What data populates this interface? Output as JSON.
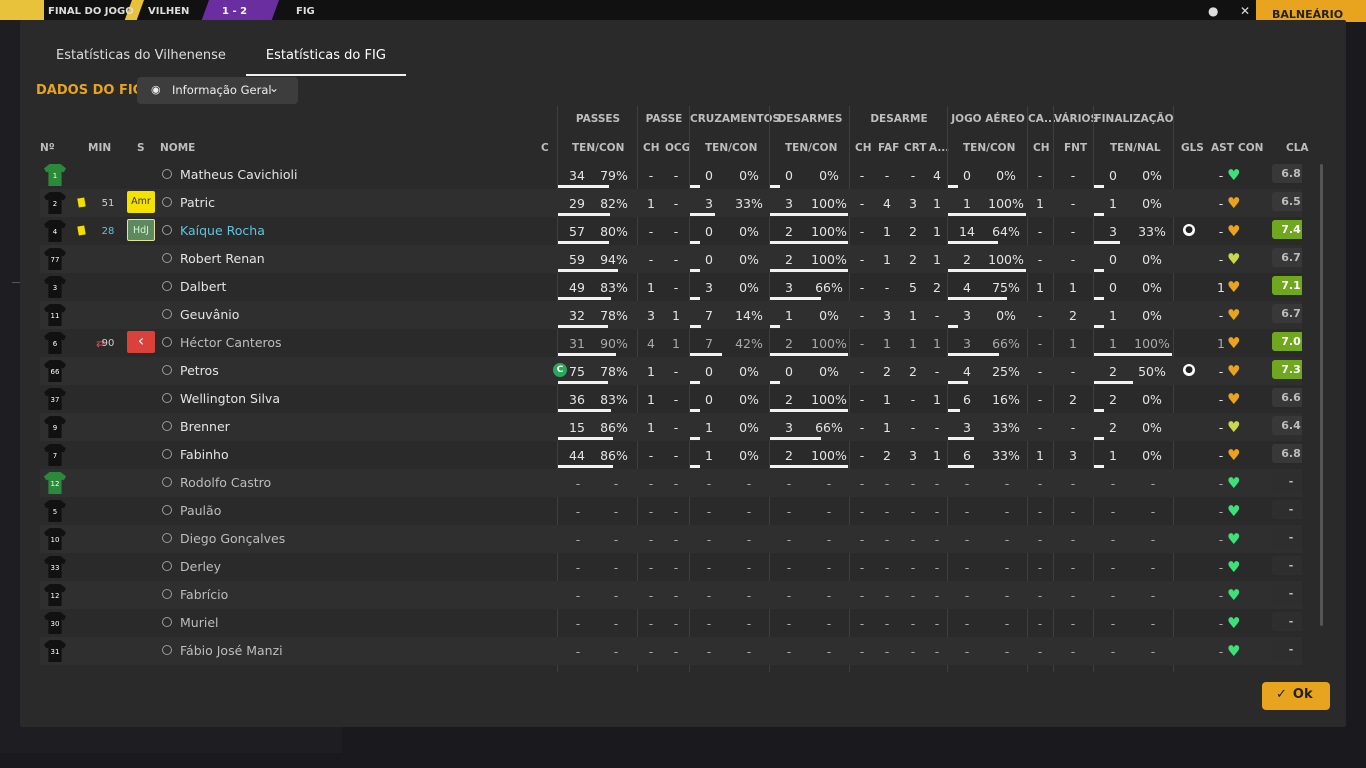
{
  "topbar": {
    "status": "FINAL DO JOGO",
    "home_team": "VILHEN",
    "score": "1 - 2",
    "away_team": "FIG",
    "right_icons": [
      "people-icon",
      "close-icon"
    ],
    "right_button": "BALNEÁRIO"
  },
  "tabs": [
    {
      "label": "Estatísticas do Vilhenense",
      "active": false
    },
    {
      "label": "Estatísticas do FIG",
      "active": true
    }
  ],
  "section_title": "DADOS DO FIG",
  "view_select": {
    "label": "Informação Geral"
  },
  "groups": [
    "PASSES",
    "PASSE",
    "CRUZAMENTOS",
    "DESARMES",
    "DESARME",
    "JOGO AÉREO",
    "CA...",
    "VÁRIOS",
    "FINALIZAÇÃO"
  ],
  "columns": [
    "Nº",
    "MIN",
    "S",
    "NOME",
    "C",
    "TEN/CON",
    "CH",
    "OCG",
    "TEN/CON",
    "TEN/CON",
    "CH",
    "FAF",
    "CRT",
    "A...",
    "TEN/CON",
    "CH",
    "FNT",
    "TEN/NAL",
    "GLS",
    "AST",
    "CON",
    "CLA"
  ],
  "colors": {
    "accent": "#e8a41e",
    "link": "#5fc4de",
    "rating_good": "#6fa81f",
    "heart_green": "#3ee07a",
    "heart_orange": "#e8a41e"
  },
  "players": [
    {
      "num": "1",
      "gk": true,
      "card": false,
      "min": "",
      "pos": "",
      "name": "Matheus Cavichioli",
      "link": false,
      "c": "",
      "pass": [
        "34",
        "79%"
      ],
      "pass_pct": 79,
      "ch": "-",
      "ocg": "-",
      "cross": [
        "0",
        "0%"
      ],
      "cross_pct": 0,
      "tack": [
        "0",
        "0%"
      ],
      "tack_pct": 0,
      "d_ch": "-",
      "faf": "-",
      "crt": "-",
      "a": "4",
      "air": [
        "0",
        "0%"
      ],
      "air_pct": 0,
      "ca": "-",
      "fnt": "-",
      "shots": [
        "0",
        "0%"
      ],
      "shot_pct": 0,
      "gls": "",
      "ast": "-",
      "con": "green",
      "cla": "6.8",
      "cla_good": false
    },
    {
      "num": "2",
      "gk": false,
      "card": true,
      "min": "51",
      "pos": "Amr",
      "name": "Patric",
      "link": false,
      "c": "",
      "pass": [
        "29",
        "82%"
      ],
      "pass_pct": 82,
      "ch": "1",
      "ocg": "-",
      "cross": [
        "3",
        "33%"
      ],
      "cross_pct": 33,
      "tack": [
        "3",
        "100%"
      ],
      "tack_pct": 100,
      "d_ch": "-",
      "faf": "4",
      "crt": "3",
      "a": "1",
      "air": [
        "1",
        "100%"
      ],
      "air_pct": 100,
      "ca": "1",
      "fnt": "-",
      "shots": [
        "1",
        "0%"
      ],
      "shot_pct": 0,
      "gls": "",
      "ast": "-",
      "con": "orange",
      "cla": "6.5",
      "cla_good": false
    },
    {
      "num": "4",
      "gk": false,
      "card": true,
      "min": "28",
      "pos": "HdJ",
      "name": "Kaíque Rocha",
      "link": true,
      "c": "",
      "pass": [
        "57",
        "80%"
      ],
      "pass_pct": 80,
      "ch": "-",
      "ocg": "-",
      "cross": [
        "0",
        "0%"
      ],
      "cross_pct": 0,
      "tack": [
        "2",
        "100%"
      ],
      "tack_pct": 100,
      "d_ch": "-",
      "faf": "1",
      "crt": "2",
      "a": "1",
      "air": [
        "14",
        "64%"
      ],
      "air_pct": 64,
      "ca": "-",
      "fnt": "-",
      "shots": [
        "3",
        "33%"
      ],
      "shot_pct": 33,
      "gls": "ball",
      "ast": "-",
      "con": "orange",
      "cla": "7.4",
      "cla_good": true
    },
    {
      "num": "77",
      "gk": false,
      "card": false,
      "min": "",
      "pos": "",
      "name": "Robert Renan",
      "link": false,
      "c": "",
      "pass": [
        "59",
        "94%"
      ],
      "pass_pct": 94,
      "ch": "-",
      "ocg": "-",
      "cross": [
        "0",
        "0%"
      ],
      "cross_pct": 0,
      "tack": [
        "2",
        "100%"
      ],
      "tack_pct": 100,
      "d_ch": "-",
      "faf": "1",
      "crt": "2",
      "a": "1",
      "air": [
        "2",
        "100%"
      ],
      "air_pct": 100,
      "ca": "-",
      "fnt": "-",
      "shots": [
        "0",
        "0%"
      ],
      "shot_pct": 0,
      "gls": "",
      "ast": "-",
      "con": "yellow",
      "cla": "6.7",
      "cla_good": false
    },
    {
      "num": "3",
      "gk": false,
      "card": false,
      "min": "",
      "pos": "",
      "name": "Dalbert",
      "link": false,
      "c": "",
      "pass": [
        "49",
        "83%"
      ],
      "pass_pct": 83,
      "ch": "1",
      "ocg": "-",
      "cross": [
        "3",
        "0%"
      ],
      "cross_pct": 0,
      "tack": [
        "3",
        "66%"
      ],
      "tack_pct": 66,
      "d_ch": "-",
      "faf": "-",
      "crt": "5",
      "a": "2",
      "air": [
        "4",
        "75%"
      ],
      "air_pct": 75,
      "ca": "1",
      "fnt": "1",
      "shots": [
        "0",
        "0%"
      ],
      "shot_pct": 0,
      "gls": "",
      "ast": "1",
      "con": "orange",
      "cla": "7.1",
      "cla_good": true
    },
    {
      "num": "11",
      "gk": false,
      "card": false,
      "min": "",
      "pos": "",
      "name": "Geuvânio",
      "link": false,
      "c": "",
      "pass": [
        "32",
        "78%"
      ],
      "pass_pct": 78,
      "ch": "3",
      "ocg": "1",
      "cross": [
        "7",
        "14%"
      ],
      "cross_pct": 14,
      "tack": [
        "1",
        "0%"
      ],
      "tack_pct": 0,
      "d_ch": "-",
      "faf": "3",
      "crt": "1",
      "a": "-",
      "air": [
        "3",
        "0%"
      ],
      "air_pct": 0,
      "ca": "-",
      "fnt": "2",
      "shots": [
        "1",
        "0%"
      ],
      "shot_pct": 0,
      "gls": "",
      "ast": "-",
      "con": "orange",
      "cla": "6.7",
      "cla_good": false
    },
    {
      "num": "6",
      "gk": false,
      "card": false,
      "sub": true,
      "min": "90",
      "pos": "out",
      "name": "Héctor Canteros",
      "link": false,
      "dim": true,
      "c": "",
      "pass": [
        "31",
        "90%"
      ],
      "pass_pct": 90,
      "ch": "4",
      "ocg": "1",
      "cross": [
        "7",
        "42%"
      ],
      "cross_pct": 42,
      "tack": [
        "2",
        "100%"
      ],
      "tack_pct": 100,
      "d_ch": "-",
      "faf": "1",
      "crt": "1",
      "a": "1",
      "air": [
        "3",
        "66%"
      ],
      "air_pct": 66,
      "ca": "-",
      "fnt": "1",
      "shots": [
        "1",
        "100%"
      ],
      "shot_pct": 100,
      "gls": "",
      "ast": "1",
      "con": "orange",
      "cla": "7.0",
      "cla_good": true
    },
    {
      "num": "66",
      "gk": false,
      "card": false,
      "min": "",
      "pos": "",
      "name": "Petros",
      "link": false,
      "c": "C",
      "pass": [
        "75",
        "78%"
      ],
      "pass_pct": 78,
      "ch": "1",
      "ocg": "-",
      "cross": [
        "0",
        "0%"
      ],
      "cross_pct": 0,
      "tack": [
        "0",
        "0%"
      ],
      "tack_pct": 0,
      "d_ch": "-",
      "faf": "2",
      "crt": "2",
      "a": "-",
      "air": [
        "4",
        "25%"
      ],
      "air_pct": 25,
      "ca": "-",
      "fnt": "-",
      "shots": [
        "2",
        "50%"
      ],
      "shot_pct": 50,
      "gls": "ball",
      "ast": "-",
      "con": "orange",
      "cla": "7.3",
      "cla_good": true
    },
    {
      "num": "37",
      "gk": false,
      "card": false,
      "min": "",
      "pos": "",
      "name": "Wellington Silva",
      "link": false,
      "c": "",
      "pass": [
        "36",
        "83%"
      ],
      "pass_pct": 83,
      "ch": "1",
      "ocg": "-",
      "cross": [
        "0",
        "0%"
      ],
      "cross_pct": 0,
      "tack": [
        "2",
        "100%"
      ],
      "tack_pct": 100,
      "d_ch": "-",
      "faf": "1",
      "crt": "-",
      "a": "1",
      "air": [
        "6",
        "16%"
      ],
      "air_pct": 16,
      "ca": "-",
      "fnt": "2",
      "shots": [
        "2",
        "0%"
      ],
      "shot_pct": 0,
      "gls": "",
      "ast": "-",
      "con": "orange",
      "cla": "6.6",
      "cla_good": false
    },
    {
      "num": "9",
      "gk": false,
      "card": false,
      "min": "",
      "pos": "",
      "name": "Brenner",
      "link": false,
      "c": "",
      "pass": [
        "15",
        "86%"
      ],
      "pass_pct": 86,
      "ch": "1",
      "ocg": "-",
      "cross": [
        "1",
        "0%"
      ],
      "cross_pct": 0,
      "tack": [
        "3",
        "66%"
      ],
      "tack_pct": 66,
      "d_ch": "-",
      "faf": "1",
      "crt": "-",
      "a": "-",
      "air": [
        "3",
        "33%"
      ],
      "air_pct": 33,
      "ca": "-",
      "fnt": "-",
      "shots": [
        "2",
        "0%"
      ],
      "shot_pct": 0,
      "gls": "",
      "ast": "-",
      "con": "yellow",
      "cla": "6.4",
      "cla_good": false
    },
    {
      "num": "7",
      "gk": false,
      "card": false,
      "min": "",
      "pos": "",
      "name": "Fabinho",
      "link": false,
      "c": "",
      "pass": [
        "44",
        "86%"
      ],
      "pass_pct": 86,
      "ch": "-",
      "ocg": "-",
      "cross": [
        "1",
        "0%"
      ],
      "cross_pct": 0,
      "tack": [
        "2",
        "100%"
      ],
      "tack_pct": 100,
      "d_ch": "-",
      "faf": "2",
      "crt": "3",
      "a": "1",
      "air": [
        "6",
        "33%"
      ],
      "air_pct": 33,
      "ca": "1",
      "fnt": "3",
      "shots": [
        "1",
        "0%"
      ],
      "shot_pct": 0,
      "gls": "",
      "ast": "-",
      "con": "orange",
      "cla": "6.8",
      "cla_good": false
    },
    {
      "num": "12",
      "gk": true,
      "bench": true,
      "name": "Rodolfo Castro"
    },
    {
      "num": "5",
      "bench": true,
      "name": "Paulão"
    },
    {
      "num": "10",
      "bench": true,
      "name": "Diego Gonçalves"
    },
    {
      "num": "33",
      "bench": true,
      "name": "Derley"
    },
    {
      "num": "12",
      "bench": true,
      "name": "Fabrício"
    },
    {
      "num": "30",
      "bench": true,
      "name": "Muriel"
    },
    {
      "num": "31",
      "bench": true,
      "name": "Fábio José Manzi"
    }
  ],
  "ok_button": "Ok"
}
